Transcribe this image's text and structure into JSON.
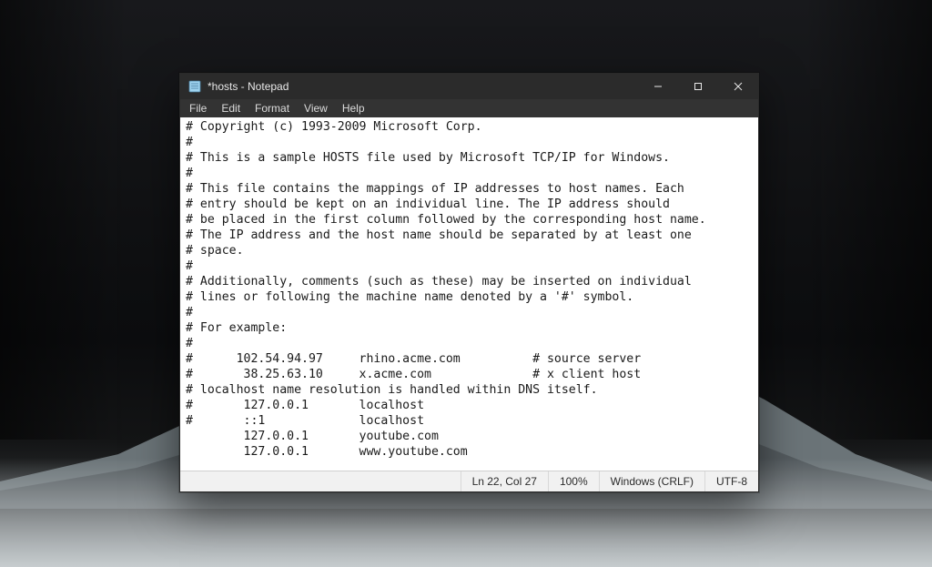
{
  "window": {
    "title": "*hosts - Notepad"
  },
  "menu": {
    "file": "File",
    "edit": "Edit",
    "format": "Format",
    "view": "View",
    "help": "Help"
  },
  "editor": {
    "content": "# Copyright (c) 1993-2009 Microsoft Corp.\n#\n# This is a sample HOSTS file used by Microsoft TCP/IP for Windows.\n#\n# This file contains the mappings of IP addresses to host names. Each\n# entry should be kept on an individual line. The IP address should\n# be placed in the first column followed by the corresponding host name.\n# The IP address and the host name should be separated by at least one\n# space.\n#\n# Additionally, comments (such as these) may be inserted on individual\n# lines or following the machine name denoted by a '#' symbol.\n#\n# For example:\n#\n#      102.54.94.97     rhino.acme.com          # source server\n#       38.25.63.10     x.acme.com              # x client host\n# localhost name resolution is handled within DNS itself.\n#       127.0.0.1       localhost\n#       ::1             localhost\n        127.0.0.1       youtube.com\n        127.0.0.1       www.youtube.com"
  },
  "status": {
    "position": "Ln 22, Col 27",
    "zoom": "100%",
    "line_ending": "Windows (CRLF)",
    "encoding": "UTF-8"
  }
}
